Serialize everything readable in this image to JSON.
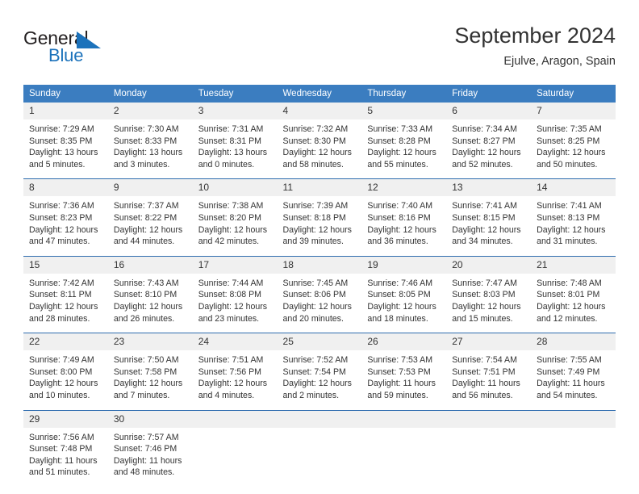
{
  "brand": {
    "name_part1": "General",
    "name_part2": "Blue",
    "accent_color": "#1c72bb"
  },
  "header": {
    "title": "September 2024",
    "location": "Ejulve, Aragon, Spain"
  },
  "calendar": {
    "header_bg": "#3b7dc0",
    "separator_color": "#2f6daf",
    "daynum_bg": "#f0f0f0",
    "weekday_headers": [
      "Sunday",
      "Monday",
      "Tuesday",
      "Wednesday",
      "Thursday",
      "Friday",
      "Saturday"
    ],
    "weeks": [
      [
        {
          "day": "1",
          "sunrise": "Sunrise: 7:29 AM",
          "sunset": "Sunset: 8:35 PM",
          "daylight1": "Daylight: 13 hours",
          "daylight2": "and 5 minutes."
        },
        {
          "day": "2",
          "sunrise": "Sunrise: 7:30 AM",
          "sunset": "Sunset: 8:33 PM",
          "daylight1": "Daylight: 13 hours",
          "daylight2": "and 3 minutes."
        },
        {
          "day": "3",
          "sunrise": "Sunrise: 7:31 AM",
          "sunset": "Sunset: 8:31 PM",
          "daylight1": "Daylight: 13 hours",
          "daylight2": "and 0 minutes."
        },
        {
          "day": "4",
          "sunrise": "Sunrise: 7:32 AM",
          "sunset": "Sunset: 8:30 PM",
          "daylight1": "Daylight: 12 hours",
          "daylight2": "and 58 minutes."
        },
        {
          "day": "5",
          "sunrise": "Sunrise: 7:33 AM",
          "sunset": "Sunset: 8:28 PM",
          "daylight1": "Daylight: 12 hours",
          "daylight2": "and 55 minutes."
        },
        {
          "day": "6",
          "sunrise": "Sunrise: 7:34 AM",
          "sunset": "Sunset: 8:27 PM",
          "daylight1": "Daylight: 12 hours",
          "daylight2": "and 52 minutes."
        },
        {
          "day": "7",
          "sunrise": "Sunrise: 7:35 AM",
          "sunset": "Sunset: 8:25 PM",
          "daylight1": "Daylight: 12 hours",
          "daylight2": "and 50 minutes."
        }
      ],
      [
        {
          "day": "8",
          "sunrise": "Sunrise: 7:36 AM",
          "sunset": "Sunset: 8:23 PM",
          "daylight1": "Daylight: 12 hours",
          "daylight2": "and 47 minutes."
        },
        {
          "day": "9",
          "sunrise": "Sunrise: 7:37 AM",
          "sunset": "Sunset: 8:22 PM",
          "daylight1": "Daylight: 12 hours",
          "daylight2": "and 44 minutes."
        },
        {
          "day": "10",
          "sunrise": "Sunrise: 7:38 AM",
          "sunset": "Sunset: 8:20 PM",
          "daylight1": "Daylight: 12 hours",
          "daylight2": "and 42 minutes."
        },
        {
          "day": "11",
          "sunrise": "Sunrise: 7:39 AM",
          "sunset": "Sunset: 8:18 PM",
          "daylight1": "Daylight: 12 hours",
          "daylight2": "and 39 minutes."
        },
        {
          "day": "12",
          "sunrise": "Sunrise: 7:40 AM",
          "sunset": "Sunset: 8:16 PM",
          "daylight1": "Daylight: 12 hours",
          "daylight2": "and 36 minutes."
        },
        {
          "day": "13",
          "sunrise": "Sunrise: 7:41 AM",
          "sunset": "Sunset: 8:15 PM",
          "daylight1": "Daylight: 12 hours",
          "daylight2": "and 34 minutes."
        },
        {
          "day": "14",
          "sunrise": "Sunrise: 7:41 AM",
          "sunset": "Sunset: 8:13 PM",
          "daylight1": "Daylight: 12 hours",
          "daylight2": "and 31 minutes."
        }
      ],
      [
        {
          "day": "15",
          "sunrise": "Sunrise: 7:42 AM",
          "sunset": "Sunset: 8:11 PM",
          "daylight1": "Daylight: 12 hours",
          "daylight2": "and 28 minutes."
        },
        {
          "day": "16",
          "sunrise": "Sunrise: 7:43 AM",
          "sunset": "Sunset: 8:10 PM",
          "daylight1": "Daylight: 12 hours",
          "daylight2": "and 26 minutes."
        },
        {
          "day": "17",
          "sunrise": "Sunrise: 7:44 AM",
          "sunset": "Sunset: 8:08 PM",
          "daylight1": "Daylight: 12 hours",
          "daylight2": "and 23 minutes."
        },
        {
          "day": "18",
          "sunrise": "Sunrise: 7:45 AM",
          "sunset": "Sunset: 8:06 PM",
          "daylight1": "Daylight: 12 hours",
          "daylight2": "and 20 minutes."
        },
        {
          "day": "19",
          "sunrise": "Sunrise: 7:46 AM",
          "sunset": "Sunset: 8:05 PM",
          "daylight1": "Daylight: 12 hours",
          "daylight2": "and 18 minutes."
        },
        {
          "day": "20",
          "sunrise": "Sunrise: 7:47 AM",
          "sunset": "Sunset: 8:03 PM",
          "daylight1": "Daylight: 12 hours",
          "daylight2": "and 15 minutes."
        },
        {
          "day": "21",
          "sunrise": "Sunrise: 7:48 AM",
          "sunset": "Sunset: 8:01 PM",
          "daylight1": "Daylight: 12 hours",
          "daylight2": "and 12 minutes."
        }
      ],
      [
        {
          "day": "22",
          "sunrise": "Sunrise: 7:49 AM",
          "sunset": "Sunset: 8:00 PM",
          "daylight1": "Daylight: 12 hours",
          "daylight2": "and 10 minutes."
        },
        {
          "day": "23",
          "sunrise": "Sunrise: 7:50 AM",
          "sunset": "Sunset: 7:58 PM",
          "daylight1": "Daylight: 12 hours",
          "daylight2": "and 7 minutes."
        },
        {
          "day": "24",
          "sunrise": "Sunrise: 7:51 AM",
          "sunset": "Sunset: 7:56 PM",
          "daylight1": "Daylight: 12 hours",
          "daylight2": "and 4 minutes."
        },
        {
          "day": "25",
          "sunrise": "Sunrise: 7:52 AM",
          "sunset": "Sunset: 7:54 PM",
          "daylight1": "Daylight: 12 hours",
          "daylight2": "and 2 minutes."
        },
        {
          "day": "26",
          "sunrise": "Sunrise: 7:53 AM",
          "sunset": "Sunset: 7:53 PM",
          "daylight1": "Daylight: 11 hours",
          "daylight2": "and 59 minutes."
        },
        {
          "day": "27",
          "sunrise": "Sunrise: 7:54 AM",
          "sunset": "Sunset: 7:51 PM",
          "daylight1": "Daylight: 11 hours",
          "daylight2": "and 56 minutes."
        },
        {
          "day": "28",
          "sunrise": "Sunrise: 7:55 AM",
          "sunset": "Sunset: 7:49 PM",
          "daylight1": "Daylight: 11 hours",
          "daylight2": "and 54 minutes."
        }
      ],
      [
        {
          "day": "29",
          "sunrise": "Sunrise: 7:56 AM",
          "sunset": "Sunset: 7:48 PM",
          "daylight1": "Daylight: 11 hours",
          "daylight2": "and 51 minutes."
        },
        {
          "day": "30",
          "sunrise": "Sunrise: 7:57 AM",
          "sunset": "Sunset: 7:46 PM",
          "daylight1": "Daylight: 11 hours",
          "daylight2": "and 48 minutes."
        },
        {
          "day": "",
          "sunrise": "",
          "sunset": "",
          "daylight1": "",
          "daylight2": ""
        },
        {
          "day": "",
          "sunrise": "",
          "sunset": "",
          "daylight1": "",
          "daylight2": ""
        },
        {
          "day": "",
          "sunrise": "",
          "sunset": "",
          "daylight1": "",
          "daylight2": ""
        },
        {
          "day": "",
          "sunrise": "",
          "sunset": "",
          "daylight1": "",
          "daylight2": ""
        },
        {
          "day": "",
          "sunrise": "",
          "sunset": "",
          "daylight1": "",
          "daylight2": ""
        }
      ]
    ]
  }
}
